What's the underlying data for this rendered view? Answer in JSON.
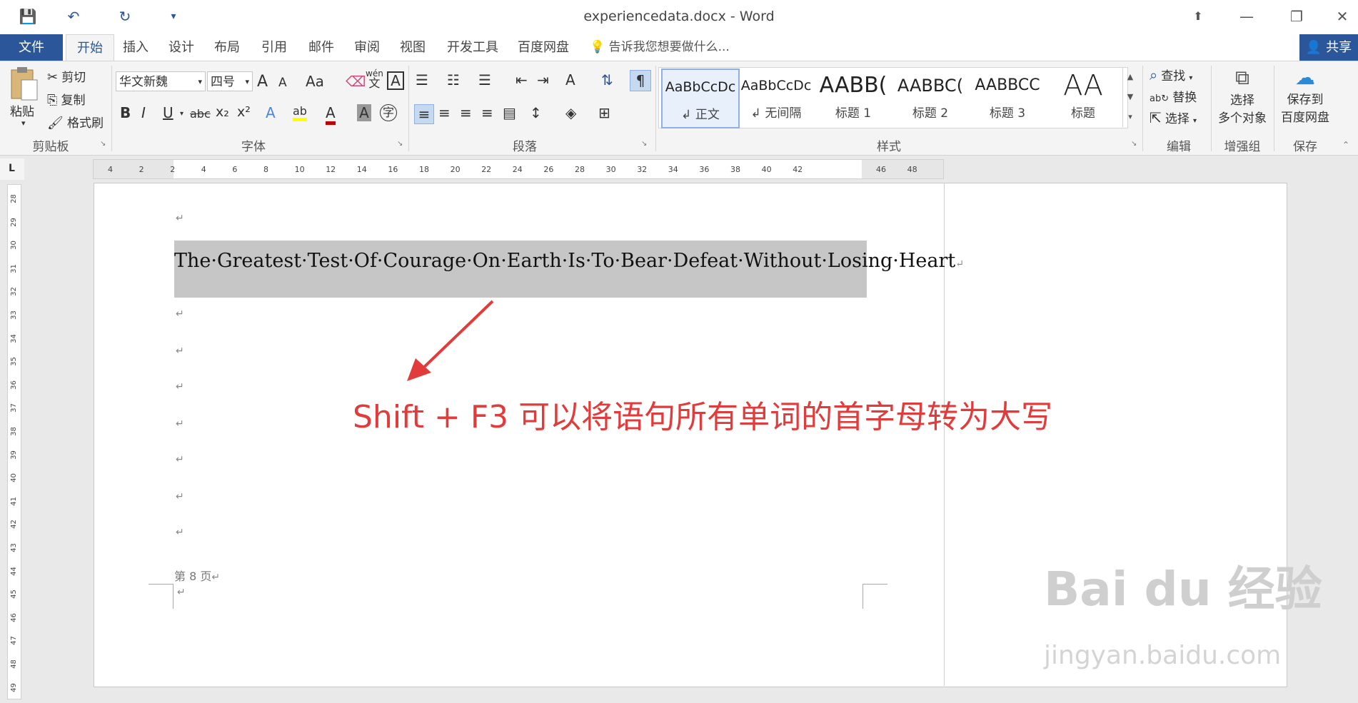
{
  "window": {
    "title": "experiencedata.docx - Word",
    "minimize": "—",
    "restore": "❐",
    "close": "✕",
    "ribbon_display": "⬆"
  },
  "quick_access": {
    "save": "💾",
    "undo": "↶",
    "redo": "↻",
    "customize": "▾"
  },
  "tabs": {
    "file": "文件",
    "items": [
      "开始",
      "插入",
      "设计",
      "布局",
      "引用",
      "邮件",
      "审阅",
      "视图",
      "开发工具",
      "百度网盘"
    ],
    "active": "开始",
    "tell_me": "告诉我您想要做什么...",
    "share": "共享"
  },
  "clipboard": {
    "paste": "粘贴",
    "cut": "剪切",
    "copy": "复制",
    "format_painter": "格式刷",
    "group": "剪贴板"
  },
  "font": {
    "name": "华文新魏",
    "size": "四号",
    "group": "字体",
    "bold": "B",
    "italic": "I",
    "underline": "U",
    "strike": "abc",
    "subscript": "x₂",
    "superscript": "x²",
    "grow": "A",
    "shrink": "A",
    "case": "Aa",
    "phonetic_top": "wén",
    "phonetic_bottom": "文",
    "border_char": "A",
    "effects": "A",
    "highlight": "ab",
    "font_color": "A",
    "shade": "A",
    "enclose": "字"
  },
  "paragraph": {
    "group": "段落"
  },
  "styles": {
    "group": "样式",
    "items": [
      {
        "preview": "AaBbCcDc",
        "name": "正文"
      },
      {
        "preview": "AaBbCcDc",
        "name": "无间隔"
      },
      {
        "preview": "AABB(",
        "name": "标题 1"
      },
      {
        "preview": "AABBC(",
        "name": "标题 2"
      },
      {
        "preview": "AABBCC",
        "name": "标题 3"
      },
      {
        "preview": "AA",
        "name": "标题"
      }
    ]
  },
  "editing": {
    "group": "编辑",
    "find": "查找",
    "replace": "替换",
    "select": "选择"
  },
  "enhance": {
    "group": "增强组",
    "line1": "选择",
    "line2": "多个对象"
  },
  "save_group": {
    "group": "保存",
    "line1": "保存到",
    "line2": "百度网盘"
  },
  "ruler": {
    "h_ticks": [
      "4",
      "2",
      "2",
      "4",
      "6",
      "8",
      "10",
      "12",
      "14",
      "16",
      "18",
      "20",
      "22",
      "24",
      "26",
      "28",
      "30",
      "32",
      "34",
      "36",
      "38",
      "40",
      "42",
      "46",
      "48"
    ],
    "v_ticks": [
      "28",
      "29",
      "30",
      "31",
      "32",
      "33",
      "34",
      "35",
      "36",
      "37",
      "38",
      "39",
      "40",
      "41",
      "42",
      "43",
      "44",
      "45",
      "46",
      "47",
      "48",
      "49"
    ],
    "corner": "L"
  },
  "document": {
    "sentence": "The·Greatest·Test·Of·Courage·On·Earth·Is·To·Bear·Defeat·Without·Losing·Heart",
    "para_mark": "↵",
    "page_label": "第 8 页",
    "annotation": "Shift + F3 可以将语句所有单词的首字母转为大写",
    "annotation_color": "#e23b3b"
  },
  "watermark": {
    "brand": "Bai du 经验",
    "url": "jingyan.baidu.com"
  }
}
